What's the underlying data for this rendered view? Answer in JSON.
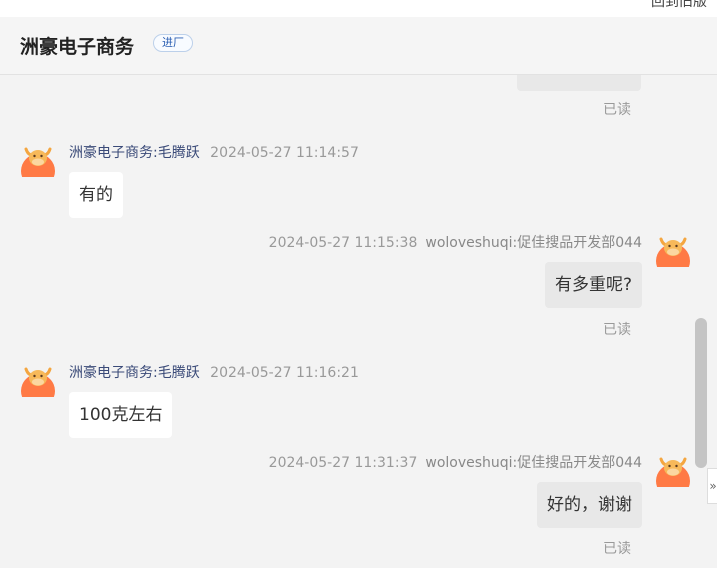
{
  "topbar": {
    "link_label": "回到旧版"
  },
  "header": {
    "title": "洲豪电子商务",
    "badge": "进厂"
  },
  "read_label": "已读",
  "messages": [
    {
      "side": "left",
      "sender": "洲豪电子商务:毛腾跃",
      "time": "2024-05-27 11:14:57",
      "text": "有的"
    },
    {
      "side": "right",
      "sender": "woloveshuqi:促佳搜品开发部044",
      "time": "2024-05-27 11:15:38",
      "text": "有多重呢?"
    },
    {
      "side": "left",
      "sender": "洲豪电子商务:毛腾跃",
      "time": "2024-05-27 11:16:21",
      "text": "100克左右"
    },
    {
      "side": "right",
      "sender": "woloveshuqi:促佳搜品开发部044",
      "time": "2024-05-27 11:31:37",
      "text": "好的，谢谢"
    }
  ],
  "edge_tab_icon": "double-chevron-right-icon",
  "avatar_icon": "cartoon-cow-avatar-icon",
  "colors": {
    "background": "#f3f3f3",
    "badge_text": "#2b5fb3",
    "sender_name": "#3a4a78",
    "avatar": "#ff7a45"
  }
}
